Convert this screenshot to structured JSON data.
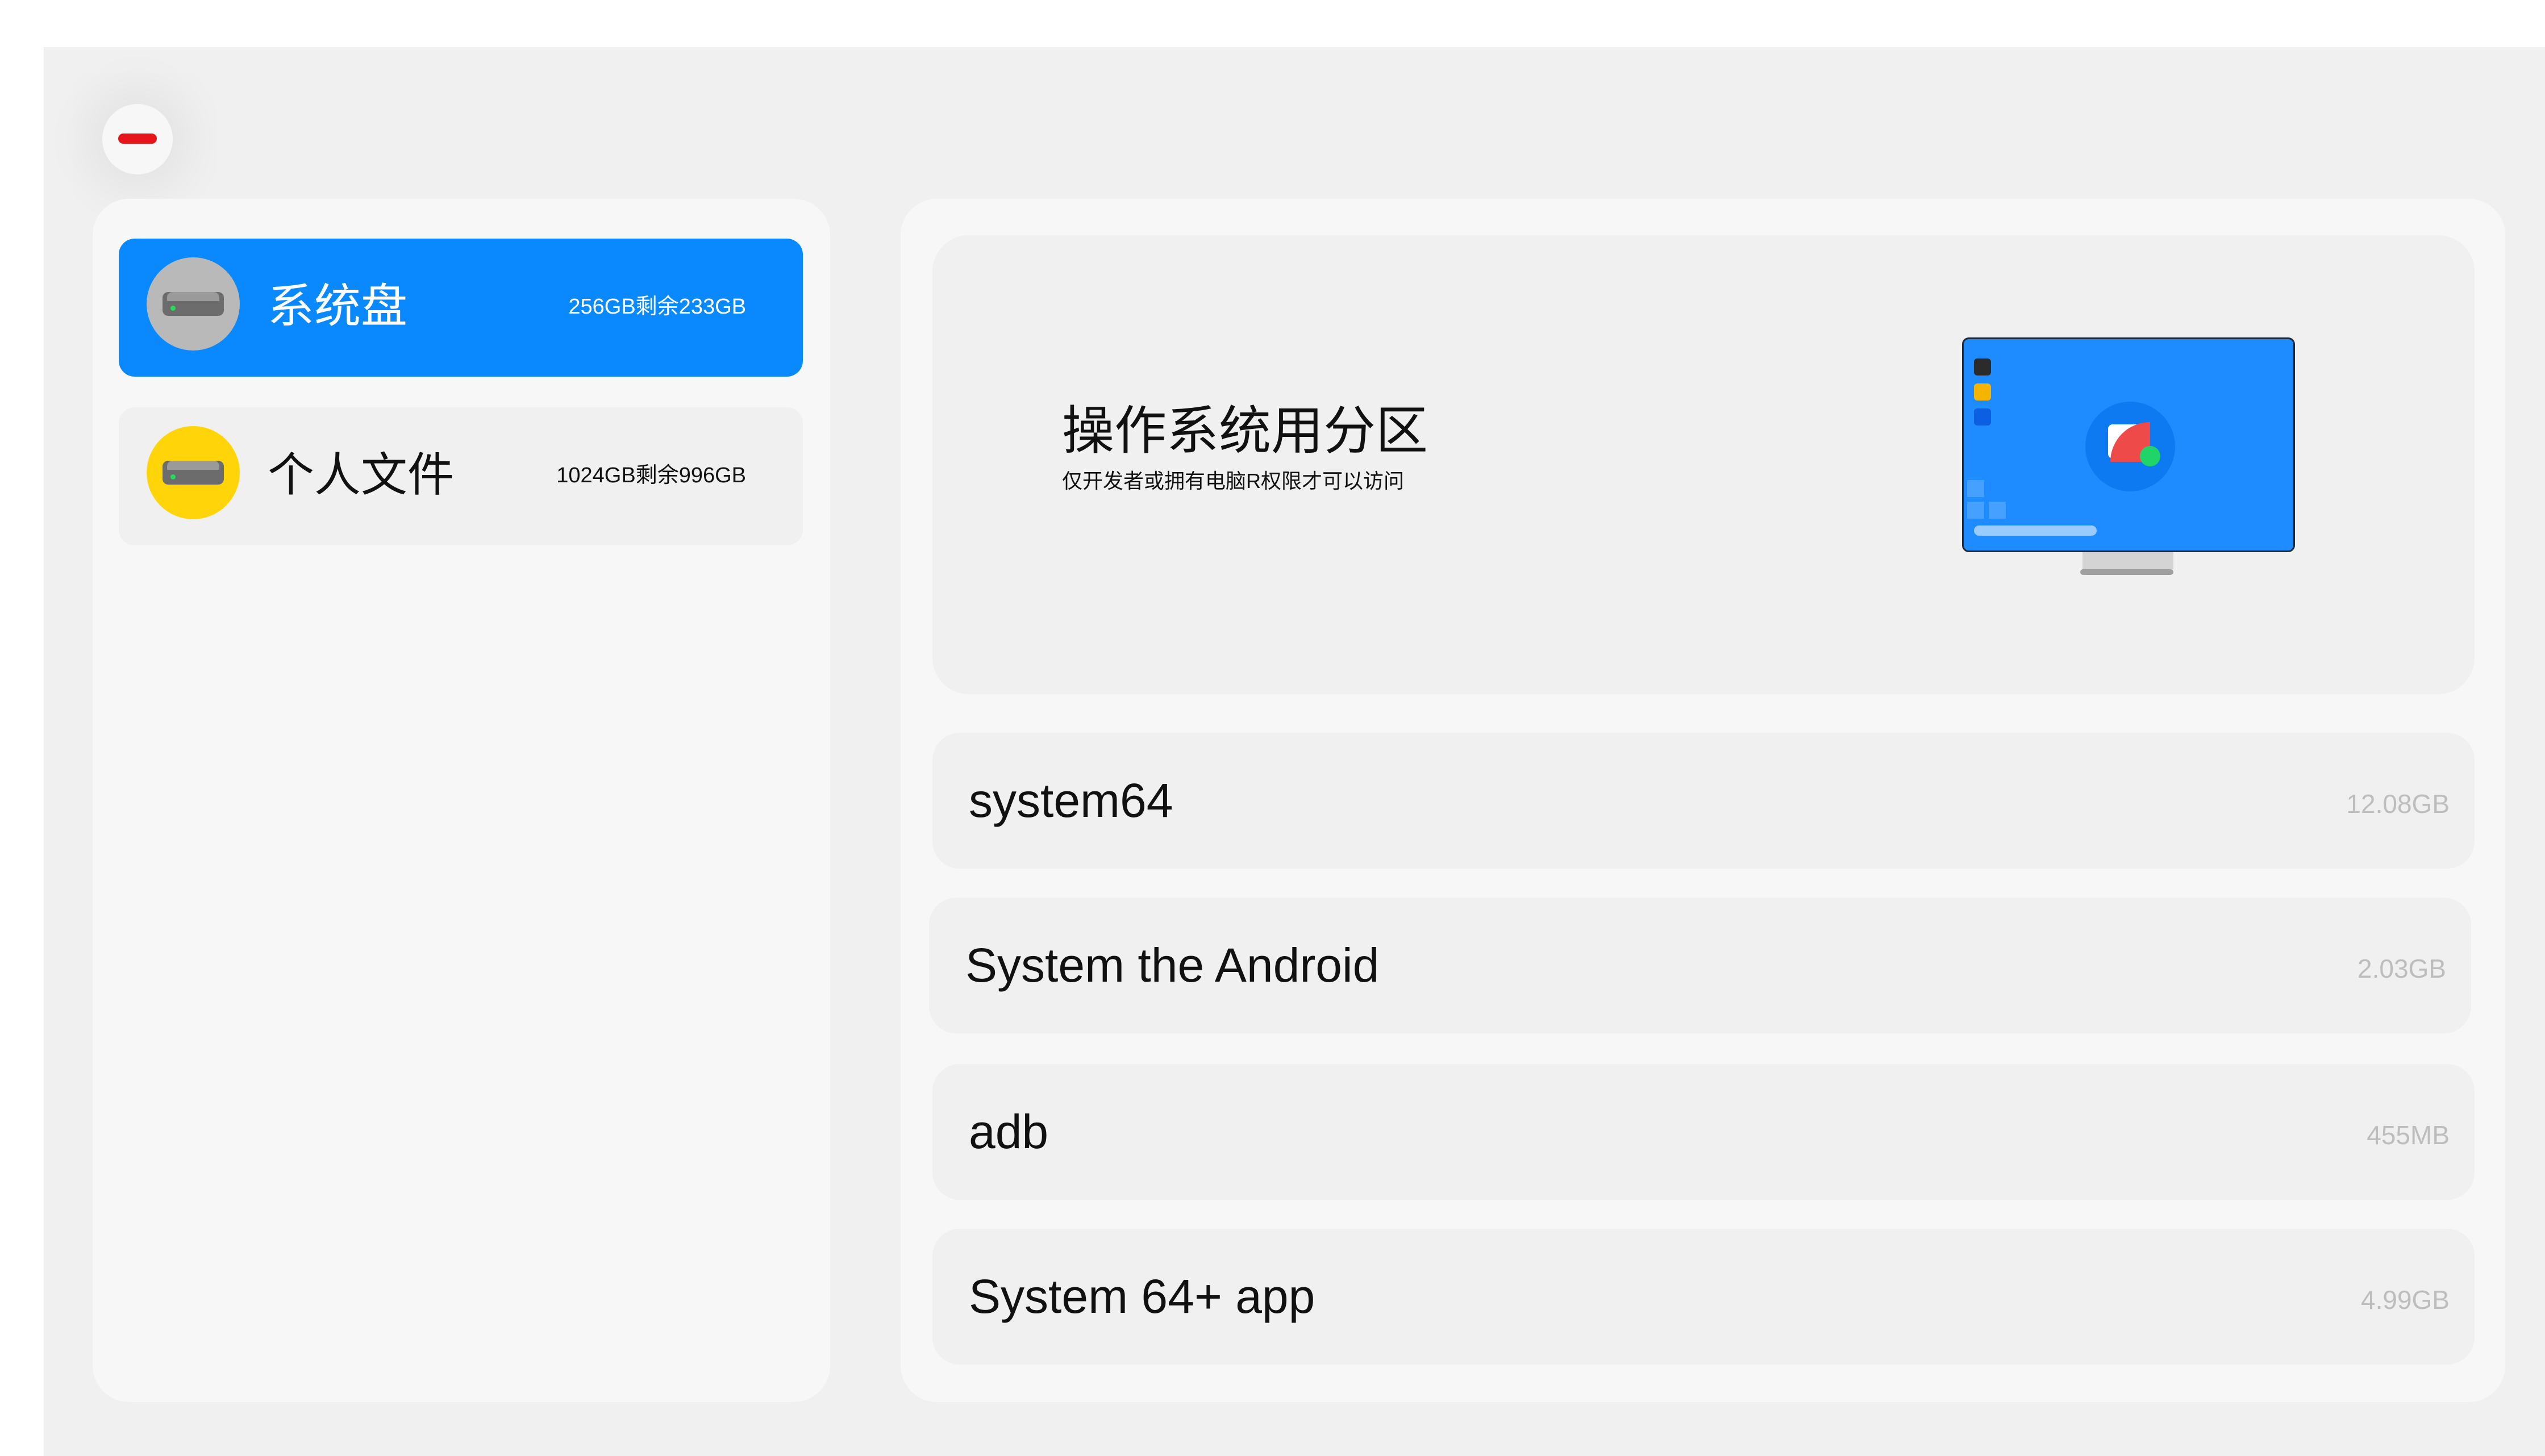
{
  "window": {
    "close_button_icon": "minus-icon",
    "accent_color": "#0a89fe",
    "close_color": "#e8141b"
  },
  "disks": [
    {
      "name": "系统盘",
      "capacity": "256GB剩余233GB",
      "icon": "hard-drive-icon",
      "icon_bg": "#b9b9b9",
      "selected": true
    },
    {
      "name": "个人文件",
      "capacity": "1024GB剩余996GB",
      "icon": "hard-drive-icon",
      "icon_bg": "#ffd50a",
      "selected": false
    }
  ],
  "hero": {
    "title": "操作系统用分区",
    "subtitle": "仅开发者或拥有电脑R权限才可以访问",
    "illustration": "monitor-icon"
  },
  "partitions": [
    {
      "name": "system64",
      "size": "12.08GB"
    },
    {
      "name": "System the Android",
      "size": "2.03GB"
    },
    {
      "name": "adb",
      "size": "455MB"
    },
    {
      "name": "System 64+ app",
      "size": "4.99GB"
    }
  ]
}
